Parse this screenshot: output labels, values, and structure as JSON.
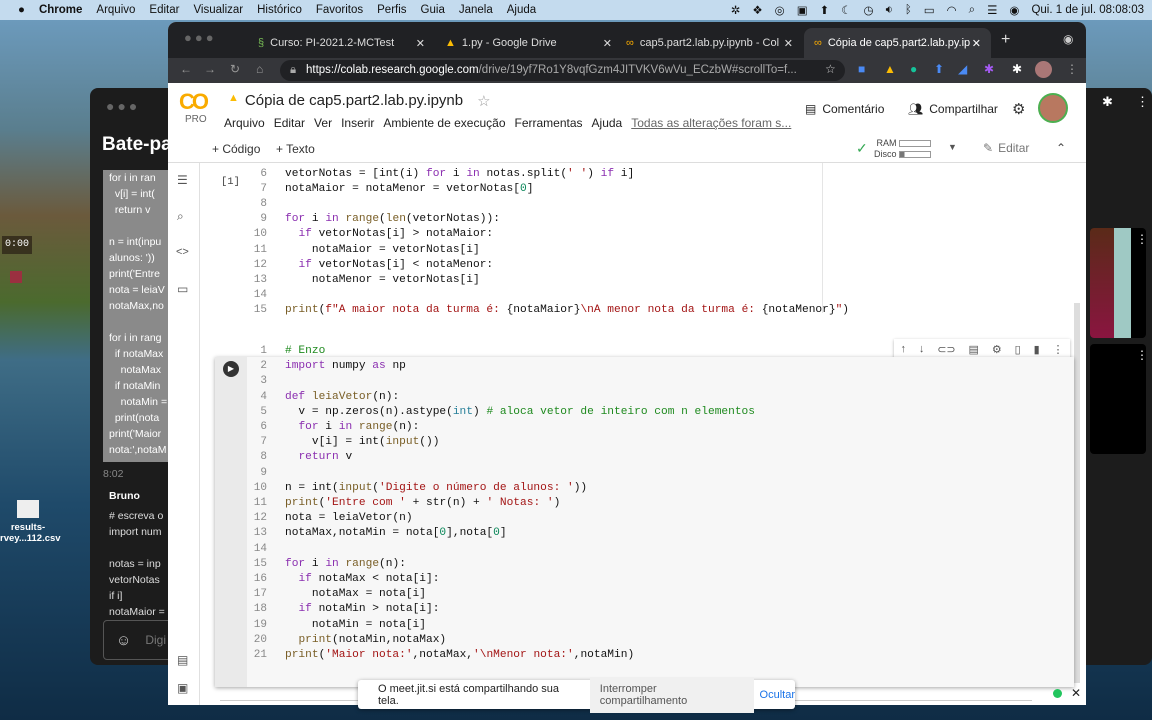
{
  "menubar": {
    "app": "Chrome",
    "items": [
      "Arquivo",
      "Editar",
      "Visualizar",
      "Histórico",
      "Favoritos",
      "Perfis",
      "Guia",
      "Janela",
      "Ajuda"
    ],
    "clock": "Qui. 1 de jul.  08:08:03"
  },
  "desktop": {
    "timer": "0:00",
    "file_name_1": "results-",
    "file_name_2": "rvey...112.csv"
  },
  "jitsi": {
    "chat_title": "Bate-pa",
    "selected_lines": "for i in ran\n  v[i] = int(\n  return v\n\nn = int(inpu\nalunos: '))\nprint('Entre\nnota = leiaV\nnotaMax,no\n\nfor i in rang\n  if notaMax\n    notaMax\n  if notaMin\n    notaMin =\n  print(nota\nprint('Maior\nnota:',notaM",
    "time": "8:02",
    "sender": "Bruno",
    "message": "# escreva o\nimport num\n\nnotas = inp\nvetorNotas\nif i]\nnotaMaior =",
    "input_placeholder": "Digi"
  },
  "browser": {
    "tabs": [
      {
        "label": "Curso: PI-2021.2-MCTest"
      },
      {
        "label": "1.py - Google Drive"
      },
      {
        "label": "cap5.part2.lab.py.ipynb - Col"
      },
      {
        "label": "Cópia de cap5.part2.lab.py.ip"
      }
    ],
    "url_host": "https://colab.research.google.com",
    "url_path": "/drive/19yf7Ro1Y8vqfGzm4JITVKV6wVu_ECzbW#scrollTo=f..."
  },
  "colab": {
    "logo": "CO",
    "pro": "PRO",
    "title": "Cópia de cap5.part2.lab.py.ipynb",
    "menu": [
      "Arquivo",
      "Editar",
      "Ver",
      "Inserir",
      "Ambiente de execução",
      "Ferramentas",
      "Ajuda"
    ],
    "save_status": "Todas as alterações foram s...",
    "comment": "Comentário",
    "share": "Compartilhar",
    "add_code": "+ Código",
    "add_text": "+ Texto",
    "ram": "RAM",
    "disk": "Disco",
    "edit": "Editar",
    "cell1_exec": "[1]",
    "cell1": {
      "start": 6,
      "lines": [
        [
          [
            "p",
            "vetorNotas = [int(i) "
          ],
          [
            "k",
            "for"
          ],
          [
            "p",
            " i "
          ],
          [
            "k",
            "in"
          ],
          [
            "p",
            " notas.split("
          ],
          [
            "s",
            "' '"
          ],
          [
            "p",
            ") "
          ],
          [
            "k",
            "if"
          ],
          [
            "p",
            " i]"
          ]
        ],
        [
          [
            "p",
            "notaMaior = notaMenor = vetorNotas["
          ],
          [
            "n",
            "0"
          ],
          [
            "p",
            "]"
          ]
        ],
        [],
        [
          [
            "k",
            "for"
          ],
          [
            "p",
            " i "
          ],
          [
            "k",
            "in"
          ],
          [
            "p",
            " "
          ],
          [
            "f",
            "range"
          ],
          [
            "p",
            "("
          ],
          [
            "f",
            "len"
          ],
          [
            "p",
            "(vetorNotas)):"
          ]
        ],
        [
          [
            "p",
            "  "
          ],
          [
            "k",
            "if"
          ],
          [
            "p",
            " vetorNotas[i] > notaMaior:"
          ]
        ],
        [
          [
            "p",
            "    notaMaior = vetorNotas[i]"
          ]
        ],
        [
          [
            "p",
            "  "
          ],
          [
            "k",
            "if"
          ],
          [
            "p",
            " vetorNotas[i] < notaMenor:"
          ]
        ],
        [
          [
            "p",
            "    notaMenor = vetorNotas[i]"
          ]
        ],
        [],
        [
          [
            "f",
            "print"
          ],
          [
            "p",
            "("
          ],
          [
            "s",
            "f\"A maior nota da turma é: "
          ],
          [
            "p",
            "{notaMaior}"
          ],
          [
            "s",
            "\\nA menor nota da turma é: "
          ],
          [
            "p",
            "{notaMenor}"
          ],
          [
            "s",
            "\""
          ],
          [
            "p",
            ")"
          ]
        ]
      ]
    },
    "cell2": {
      "start": 1,
      "lines": [
        [
          [
            "c",
            "# Enzo"
          ]
        ],
        [
          [
            "k",
            "import"
          ],
          [
            "p",
            " numpy "
          ],
          [
            "k",
            "as"
          ],
          [
            "p",
            " np"
          ]
        ],
        [],
        [
          [
            "k",
            "def"
          ],
          [
            "p",
            " "
          ],
          [
            "f",
            "leiaVetor"
          ],
          [
            "p",
            "(n):"
          ]
        ],
        [
          [
            "p",
            "  v = np.zeros(n).astype("
          ],
          [
            "b",
            "int"
          ],
          [
            "p",
            ") "
          ],
          [
            "c",
            "# aloca vetor de inteiro com n elementos"
          ]
        ],
        [
          [
            "p",
            "  "
          ],
          [
            "k",
            "for"
          ],
          [
            "p",
            " i "
          ],
          [
            "k",
            "in"
          ],
          [
            "p",
            " "
          ],
          [
            "f",
            "range"
          ],
          [
            "p",
            "(n):"
          ]
        ],
        [
          [
            "p",
            "    v[i] = int("
          ],
          [
            "f",
            "input"
          ],
          [
            "p",
            "())"
          ]
        ],
        [
          [
            "p",
            "  "
          ],
          [
            "k",
            "return"
          ],
          [
            "p",
            " v"
          ]
        ],
        [],
        [
          [
            "p",
            "n = int("
          ],
          [
            "f",
            "input"
          ],
          [
            "p",
            "("
          ],
          [
            "s",
            "'Digite o número de alunos: '"
          ],
          [
            "p",
            "))"
          ]
        ],
        [
          [
            "f",
            "print"
          ],
          [
            "p",
            "("
          ],
          [
            "s",
            "'Entre com '"
          ],
          [
            "p",
            " + str(n) + "
          ],
          [
            "s",
            "' Notas: '"
          ],
          [
            "p",
            ")"
          ]
        ],
        [
          [
            "p",
            "nota = leiaVetor(n)"
          ]
        ],
        [
          [
            "p",
            "notaMax,notaMin = nota["
          ],
          [
            "n",
            "0"
          ],
          [
            "p",
            "],nota["
          ],
          [
            "n",
            "0"
          ],
          [
            "p",
            "]"
          ]
        ],
        [],
        [
          [
            "k",
            "for"
          ],
          [
            "p",
            " i "
          ],
          [
            "k",
            "in"
          ],
          [
            "p",
            " "
          ],
          [
            "f",
            "range"
          ],
          [
            "p",
            "(n):"
          ]
        ],
        [
          [
            "p",
            "  "
          ],
          [
            "k",
            "if"
          ],
          [
            "p",
            " notaMax < nota[i]:"
          ]
        ],
        [
          [
            "p",
            "    notaMax = nota[i]"
          ]
        ],
        [
          [
            "p",
            "  "
          ],
          [
            "k",
            "if"
          ],
          [
            "p",
            " notaMin > nota[i]:"
          ]
        ],
        [
          [
            "p",
            "    notaMin = nota[i]"
          ]
        ],
        [
          [
            "p",
            "  "
          ],
          [
            "f",
            "print"
          ],
          [
            "p",
            "(notaMin,notaMax)"
          ]
        ],
        [
          [
            "f",
            "print"
          ],
          [
            "p",
            "("
          ],
          [
            "s",
            "'Maior nota:'"
          ],
          [
            "p",
            ",notaMax,"
          ],
          [
            "s",
            "'\\nMenor nota:'"
          ],
          [
            "p",
            ",notaMin)"
          ]
        ]
      ]
    },
    "cell_toolbar_icons": [
      "arrow-up-icon",
      "arrow-down-icon",
      "link-icon",
      "comment-icon",
      "gear-icon",
      "mirror-cell-icon",
      "trash-icon",
      "more-vert-icon"
    ]
  },
  "notification": {
    "text": "O meet.jit.si está compartilhando sua tela.",
    "stop": "Interromper compartilhamento",
    "hide": "Ocultar"
  },
  "colors": {
    "accent": "#f9ab00",
    "keyword": "#8b2fb0",
    "string": "#a31515",
    "comment": "#1f8a1f",
    "link": "#1a73e8"
  }
}
